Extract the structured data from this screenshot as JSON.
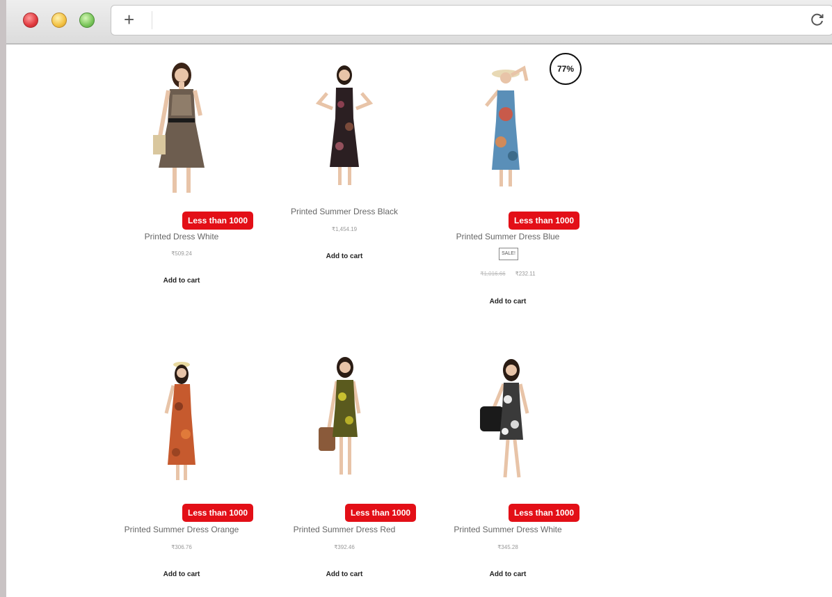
{
  "browser": {
    "icons": {
      "new_tab": "plus-icon",
      "reload": "reload-icon"
    },
    "new_tab_glyph": "+"
  },
  "colors": {
    "badge": "#e30f17"
  },
  "products": [
    {
      "badge": "Less than 1000",
      "title": "Printed Dress White",
      "price": "₹509.24",
      "cta": "Add to cart"
    },
    {
      "title": "Printed Summer Dress Black",
      "price": "₹1,454.19",
      "cta": "Add to cart"
    },
    {
      "badge": "Less than 1000",
      "title": "Printed Summer Dress Blue",
      "sale_label": "SALE!",
      "old_price": "₹1,016.66",
      "price": "₹232.11",
      "discount": "77%",
      "cta": "Add to cart"
    },
    {
      "badge": "Less than 1000",
      "title": "Printed Summer Dress Orange",
      "price": "₹306.76",
      "cta": "Add to cart"
    },
    {
      "badge": "Less than 1000",
      "title": "Printed Summer Dress Red",
      "price": "₹392.46",
      "cta": "Add to cart"
    },
    {
      "badge": "Less than 1000",
      "title": "Printed Summer Dress White",
      "price": "₹345.28",
      "cta": "Add to cart"
    }
  ]
}
